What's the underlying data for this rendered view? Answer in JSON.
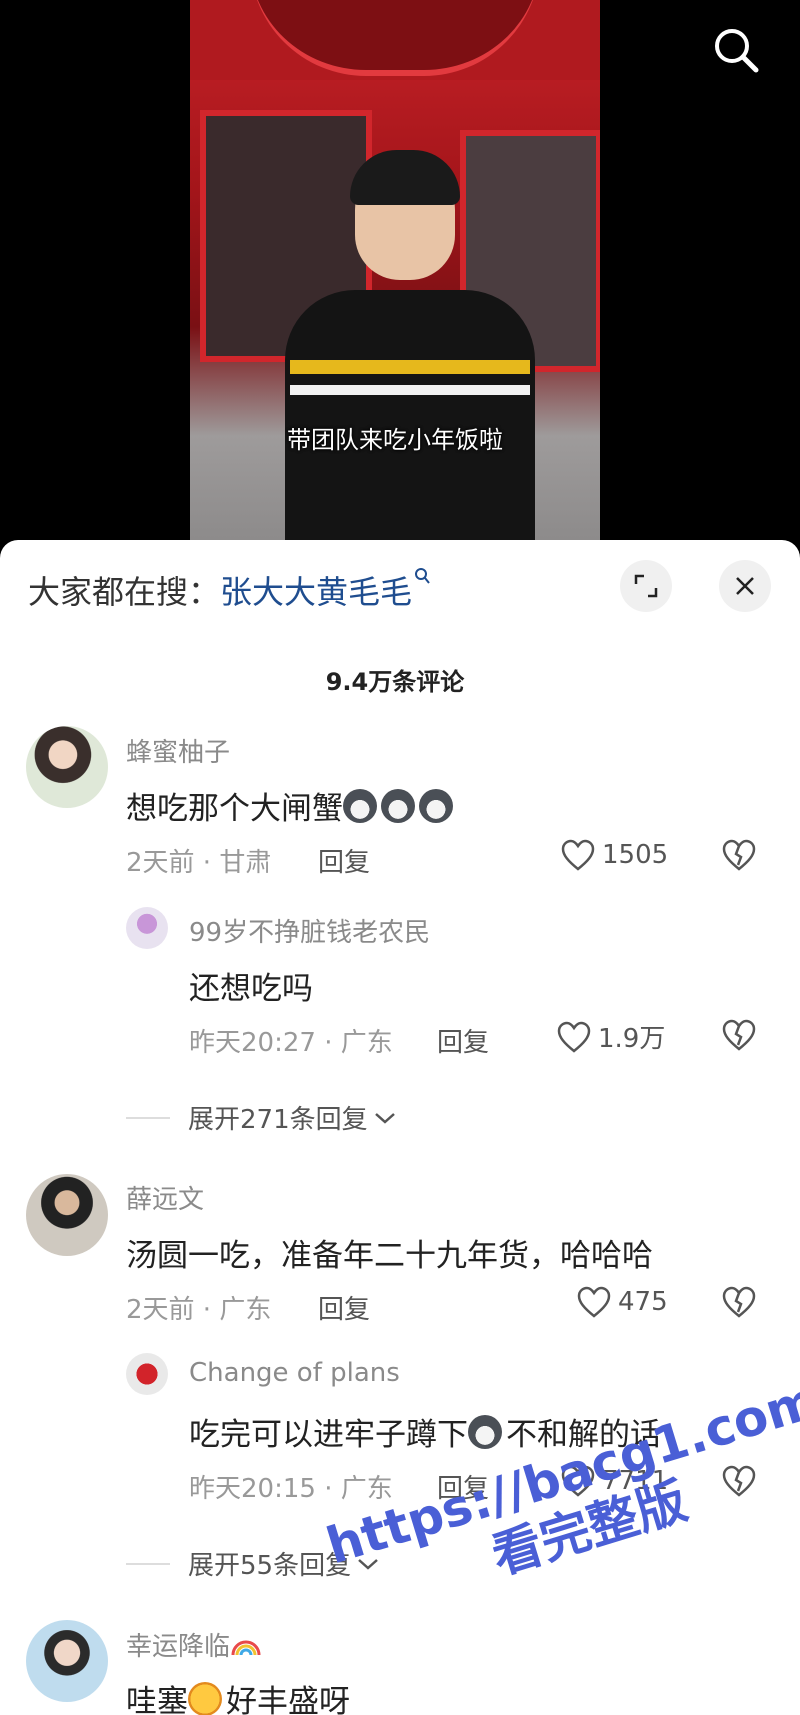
{
  "video": {
    "subtitle": "带团队来吃小年饭啦"
  },
  "hot_search": {
    "prefix": "大家都在搜：",
    "keyword": "张大大黄毛毛"
  },
  "comment_count": "9.4万条评论",
  "comments": [
    {
      "name": "蜂蜜柚子",
      "text": "想吃那个大闸蟹",
      "meta": "2天前 · 甘肃",
      "reply_label": "回复",
      "likes": "1505",
      "replies": [
        {
          "name": "99岁不挣脏钱老农民",
          "text": "还想吃吗",
          "meta": "昨天20:27 · 广东",
          "reply_label": "回复",
          "likes": "1.9万"
        }
      ],
      "expand_label": "展开271条回复"
    },
    {
      "name": "薛远文",
      "text": "汤圆一吃，准备年二十九年货，哈哈哈",
      "meta": "2天前 · 广东",
      "reply_label": "回复",
      "likes": "475",
      "replies": [
        {
          "name": "Change of plans",
          "text_a": "吃完可以进牢子蹲下",
          "text_b": "不和解的话",
          "meta": "昨天20:15 · 广东",
          "reply_label": "回复",
          "likes": "7711"
        }
      ],
      "expand_label": "展开55条回复"
    },
    {
      "name": "幸运降临",
      "text_a": "哇塞",
      "text_b": "好丰盛呀"
    }
  ],
  "watermark": {
    "line1": "https://bacg1.com",
    "line2": "看完整版"
  }
}
